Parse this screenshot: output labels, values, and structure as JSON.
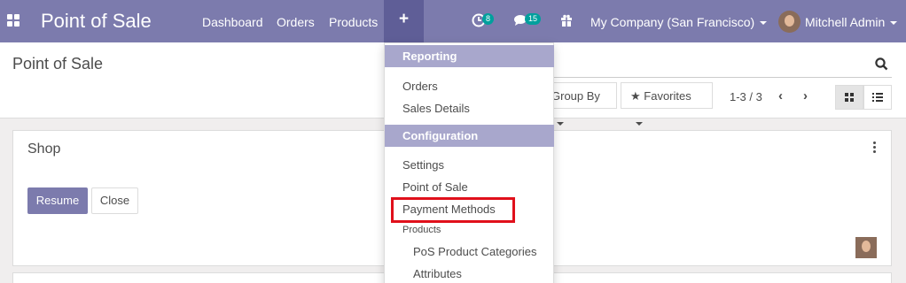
{
  "navbar": {
    "brand": "Point of Sale",
    "links": [
      "Dashboard",
      "Orders",
      "Products"
    ],
    "plus_label": "+",
    "activity_count": "8",
    "messages_count": "15",
    "company": "My Company (San Francisco)",
    "user": "Mitchell Admin"
  },
  "control_panel": {
    "breadcrumb": "Point of Sale",
    "group_by_label": "Group By",
    "favorites_label": "Favorites",
    "pager": "1-3 / 3"
  },
  "card": {
    "title": "Shop",
    "resume_label": "Resume",
    "close_label": "Close"
  },
  "dropdown": {
    "reporting_header": "Reporting",
    "reporting_items": [
      "Orders",
      "Sales Details"
    ],
    "configuration_header": "Configuration",
    "configuration_items": [
      "Settings",
      "Point of Sale",
      "Payment Methods"
    ],
    "products_label": "Products",
    "products_items": [
      "PoS Product Categories",
      "Attributes"
    ]
  },
  "colors": {
    "brand": "#7c7bad",
    "highlight": "#e0101b",
    "badge": "#00a09d"
  }
}
